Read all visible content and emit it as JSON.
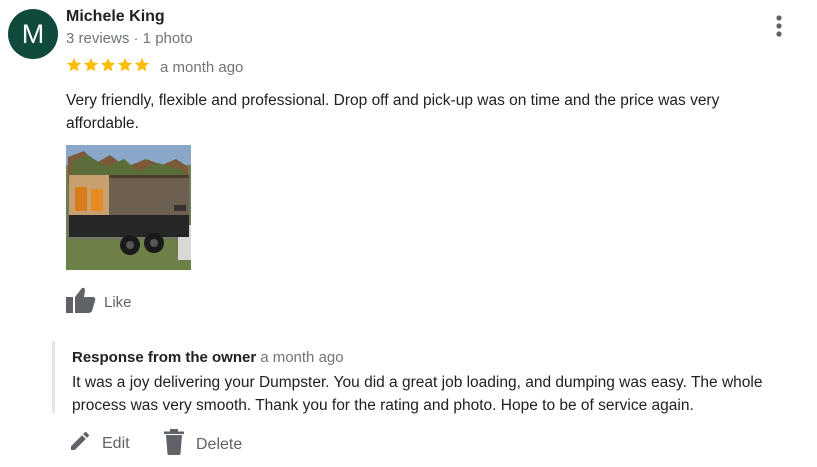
{
  "reviewer": {
    "initial": "M",
    "name": "Michele King",
    "meta": "3 reviews · 1 photo",
    "avatar_color": "#0f4a3c"
  },
  "rating": {
    "stars": 5,
    "max": 5,
    "star_color": "#fbbc04"
  },
  "review": {
    "date": "a month ago",
    "text": "Very friendly, flexible and professional.  Drop off and pick-up was on time and the price was very affordable."
  },
  "photo": {
    "subject": "dump trailer loaded with yard debris"
  },
  "actions": {
    "like_label": "Like",
    "edit_label": "Edit",
    "delete_label": "Delete"
  },
  "owner_response": {
    "title": "Response from the owner",
    "date": "a month ago",
    "text": "It was a joy delivering your Dumpster. You did a great job loading, and dumping was easy. The whole process was very smooth. Thank you for the rating and photo. Hope to be of service again."
  },
  "icons": {
    "more": "more-vert-icon",
    "star": "star-icon",
    "like": "thumb-up-icon",
    "edit": "pencil-icon",
    "delete": "trash-icon"
  }
}
